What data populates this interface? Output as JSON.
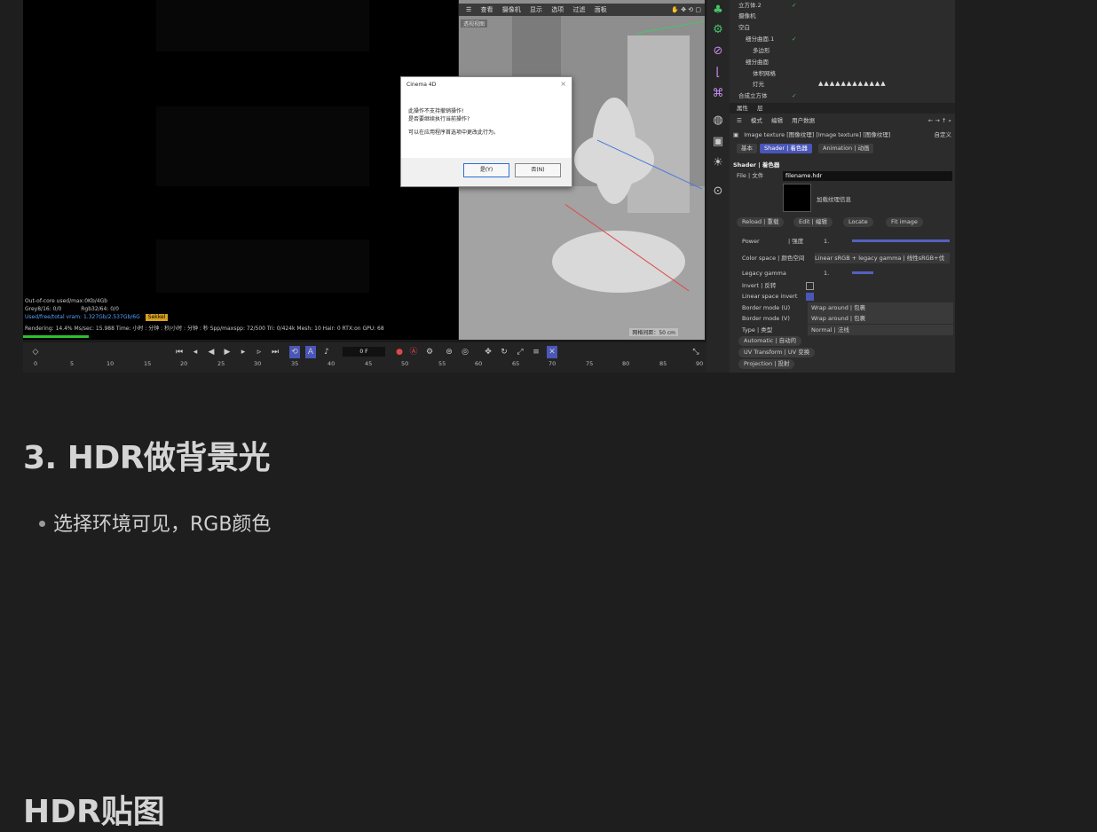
{
  "screenshot": {
    "render_info": {
      "line1": "Out-of-core used/max:0Kb/4Gb",
      "line2_a": "Grey8/16: 0/0",
      "line2_b": "Rgb32/64: 0/0",
      "line3": "Used/free/total vram: 1.327Gb/2.537Gb/6G",
      "line3_tag": "Sekkel",
      "status": "Rendering: 14.4%   Ms/sec: 15.988   Time: 小时 : 分钟 : 秒/小时 : 分钟 : 秒   Spp/maxspp: 72/500   Tri: 0/424k   Mesh: 10   Hair: 0   RTX:on   GPU: 68"
    },
    "viewport": {
      "menu": [
        "查看",
        "摄像机",
        "显示",
        "选项",
        "过滤",
        "面板"
      ],
      "label": "透视视图",
      "scale": "网格间距：50 cm"
    },
    "dialog": {
      "title": "Cinema 4D",
      "message1": "此操作不支持撤销操作!",
      "message2": "是否要继续执行当前操作?",
      "message3": "可以在应用程序首选项中更改此行为。",
      "yes": "是(Y)",
      "no": "否(N)"
    },
    "objects": [
      {
        "name": "立方体.2"
      },
      {
        "name": "摄像机"
      },
      {
        "name": "空白"
      },
      {
        "name": "细分曲面.1"
      },
      {
        "name": "多边形"
      },
      {
        "name": "细分曲面"
      },
      {
        "name": "体积网格"
      },
      {
        "name": "灯光"
      },
      {
        "name": "合成立方体"
      }
    ],
    "attr_tabs": [
      "属性",
      "层"
    ],
    "attr_toolbar": [
      "模式",
      "编辑",
      "用户数据"
    ],
    "subtitle": "Image texture [图像纹理] [Image texture] [图像纹理]",
    "subtitle_mode": "自定义",
    "chips": [
      "基本",
      "Shader | 着色器",
      "Animation | 动画"
    ],
    "section": "Shader | 着色器",
    "file_label": "File | 文件",
    "file_value": "filename.hdr",
    "thumb_label": "加载纹理信息",
    "buttons": [
      "Reload | 重载",
      "Edit | 编辑",
      "Locate",
      "Fit image"
    ],
    "power_label": "Power",
    "power_unit": "| 强度",
    "power_value": "1.",
    "colorspace_label": "Color space | 颜色空间",
    "colorspace_value": "Linear sRGB + legacy gamma | 线性sRGB+伐",
    "legacy_gamma_label": "Legacy gamma",
    "legacy_gamma_value": "1.",
    "invert_label": "Invert | 反转",
    "linear_invert_label": "Linear space invert",
    "border_u_label": "Border mode (U)",
    "border_u_value": "Wrap around | 包裹",
    "border_v_label": "Border mode (V)",
    "border_v_value": "Wrap around | 包裹",
    "type_label": "Type | 类型",
    "type_value": "Normal | 法线",
    "link_buttons": [
      "Automatic | 自动的",
      "UV Transform | UV 变换",
      "Projection | 投射"
    ],
    "timeline": {
      "frame": "0 F",
      "ruler": [
        "0",
        "5",
        "10",
        "15",
        "20",
        "25",
        "30",
        "35",
        "40",
        "45",
        "50",
        "55",
        "60",
        "65",
        "70",
        "75",
        "80",
        "85",
        "90"
      ]
    }
  },
  "heading": "3. HDR做背景光",
  "bullet": "选择环境可见，RGB颜色",
  "next_heading": "HDR贴图",
  "icons": [
    "play-icon",
    "record-icon",
    "gear-icon",
    "close-icon",
    "diamond-icon"
  ]
}
